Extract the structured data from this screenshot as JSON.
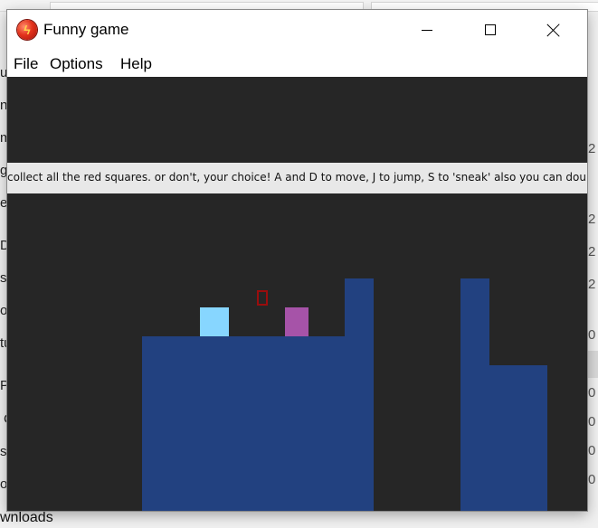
{
  "window": {
    "title": "Funny game",
    "icon": "app-flame-icon"
  },
  "menu": {
    "items": [
      "File",
      "Options",
      "Help"
    ]
  },
  "game": {
    "instructions": "collect all the red squares. or don't, your choice! A and D to move, J to jump, S to 'sneak' also you can double jump",
    "colors": {
      "background": "#262626",
      "terrain": "#224180",
      "player": "#87d6ff",
      "other_character": "#a653a8",
      "collectible_outline": "#9a0d0d",
      "instruction_bar": "#e8e8e8"
    }
  },
  "background_app": {
    "left_fragments": [
      "u",
      "n",
      "m",
      "g",
      "e",
      "D",
      "s",
      "o",
      "tu",
      "P",
      "C",
      "s",
      "o"
    ],
    "right_fragments": [
      "2",
      "2",
      "2",
      "2",
      "0",
      "0",
      "0",
      "0",
      "0",
      "0"
    ],
    "bottom_label": "wnloads"
  }
}
